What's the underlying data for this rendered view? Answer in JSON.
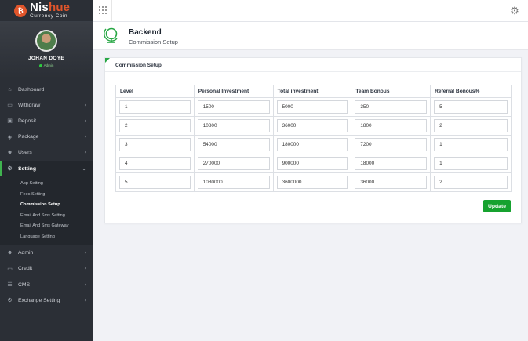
{
  "brand": {
    "name_part1": "Nis",
    "name_part2": "hue",
    "subtitle": "Currency Coin",
    "logo_glyph": "₿"
  },
  "profile": {
    "name": "JOHAN DOYE",
    "role": "Admin"
  },
  "sidebar": {
    "items": [
      {
        "label": "Dashboard",
        "icon": "home-icon",
        "glyph": "⌂",
        "chevron": false
      },
      {
        "label": "Withdraw",
        "icon": "card-icon",
        "glyph": "▭",
        "chevron": true
      },
      {
        "label": "Deposit",
        "icon": "wallet-icon",
        "glyph": "▣",
        "chevron": true
      },
      {
        "label": "Package",
        "icon": "box-icon",
        "glyph": "◈",
        "chevron": true
      },
      {
        "label": "Users",
        "icon": "users-icon",
        "glyph": "☻",
        "chevron": true
      },
      {
        "label": "Setting",
        "icon": "gear-icon",
        "glyph": "⚙",
        "chevron": true,
        "active": true
      }
    ],
    "sub_items": [
      "App Setting",
      "Fees Setting",
      "Commission Setup",
      "Email And Sms Setting",
      "Email And Sms Gateway",
      "Language Setting"
    ],
    "items_after": [
      {
        "label": "Admin",
        "icon": "users-icon",
        "glyph": "☻",
        "chevron": true
      },
      {
        "label": "Credit",
        "icon": "card-icon",
        "glyph": "▭",
        "chevron": true
      },
      {
        "label": "CMS",
        "icon": "list-icon",
        "glyph": "☰",
        "chevron": true
      },
      {
        "label": "Exchange Setting",
        "icon": "gear-icon",
        "glyph": "⚙",
        "chevron": true
      }
    ]
  },
  "header": {
    "title": "Backend",
    "subtitle": "Commission Setup"
  },
  "card": {
    "title": "Commission Setup",
    "columns": [
      "Level",
      "Personal Investment",
      "Total investment",
      "Team Bonous",
      "Referral Bonous%"
    ],
    "rows": [
      [
        "1",
        "1500",
        "5000",
        "350",
        "5"
      ],
      [
        "2",
        "10800",
        "36000",
        "1800",
        "2"
      ],
      [
        "3",
        "54000",
        "180000",
        "7200",
        "1"
      ],
      [
        "4",
        "270000",
        "900000",
        "18000",
        "1"
      ],
      [
        "5",
        "1080000",
        "3600000",
        "36000",
        "2"
      ]
    ],
    "update_label": "Update"
  },
  "colors": {
    "accent": "#16a22f",
    "brand": "#e0552b",
    "sidebar": "#2b2f36"
  }
}
